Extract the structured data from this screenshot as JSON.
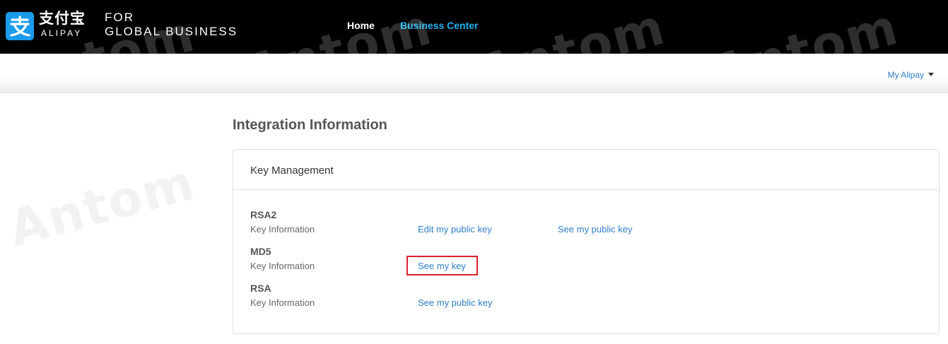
{
  "header": {
    "logo_cn": "支付宝",
    "logo_en": "ALIPAY",
    "tagline_line1": "FOR",
    "tagline_line2": "GLOBAL BUSINESS",
    "nav": {
      "home": "Home",
      "business_center": "Business Center"
    }
  },
  "subheader": {
    "account_menu": "My Alipay"
  },
  "page": {
    "title": "Integration Information"
  },
  "panel": {
    "title": "Key Management",
    "keys": [
      {
        "name": "RSA2",
        "info": "Key Information",
        "links": [
          "Edit my public key",
          "See my public key"
        ]
      },
      {
        "name": "MD5",
        "info": "Key Information",
        "links": [
          "See my key"
        ]
      },
      {
        "name": "RSA",
        "info": "Key Information",
        "links": [
          "See my public key"
        ]
      }
    ]
  },
  "watermark": {
    "text": "Antom"
  },
  "colors": {
    "header_bg": "#000000",
    "accent": "#1fb4f5",
    "link": "#2d7fc9",
    "highlight": "#d9232e"
  }
}
